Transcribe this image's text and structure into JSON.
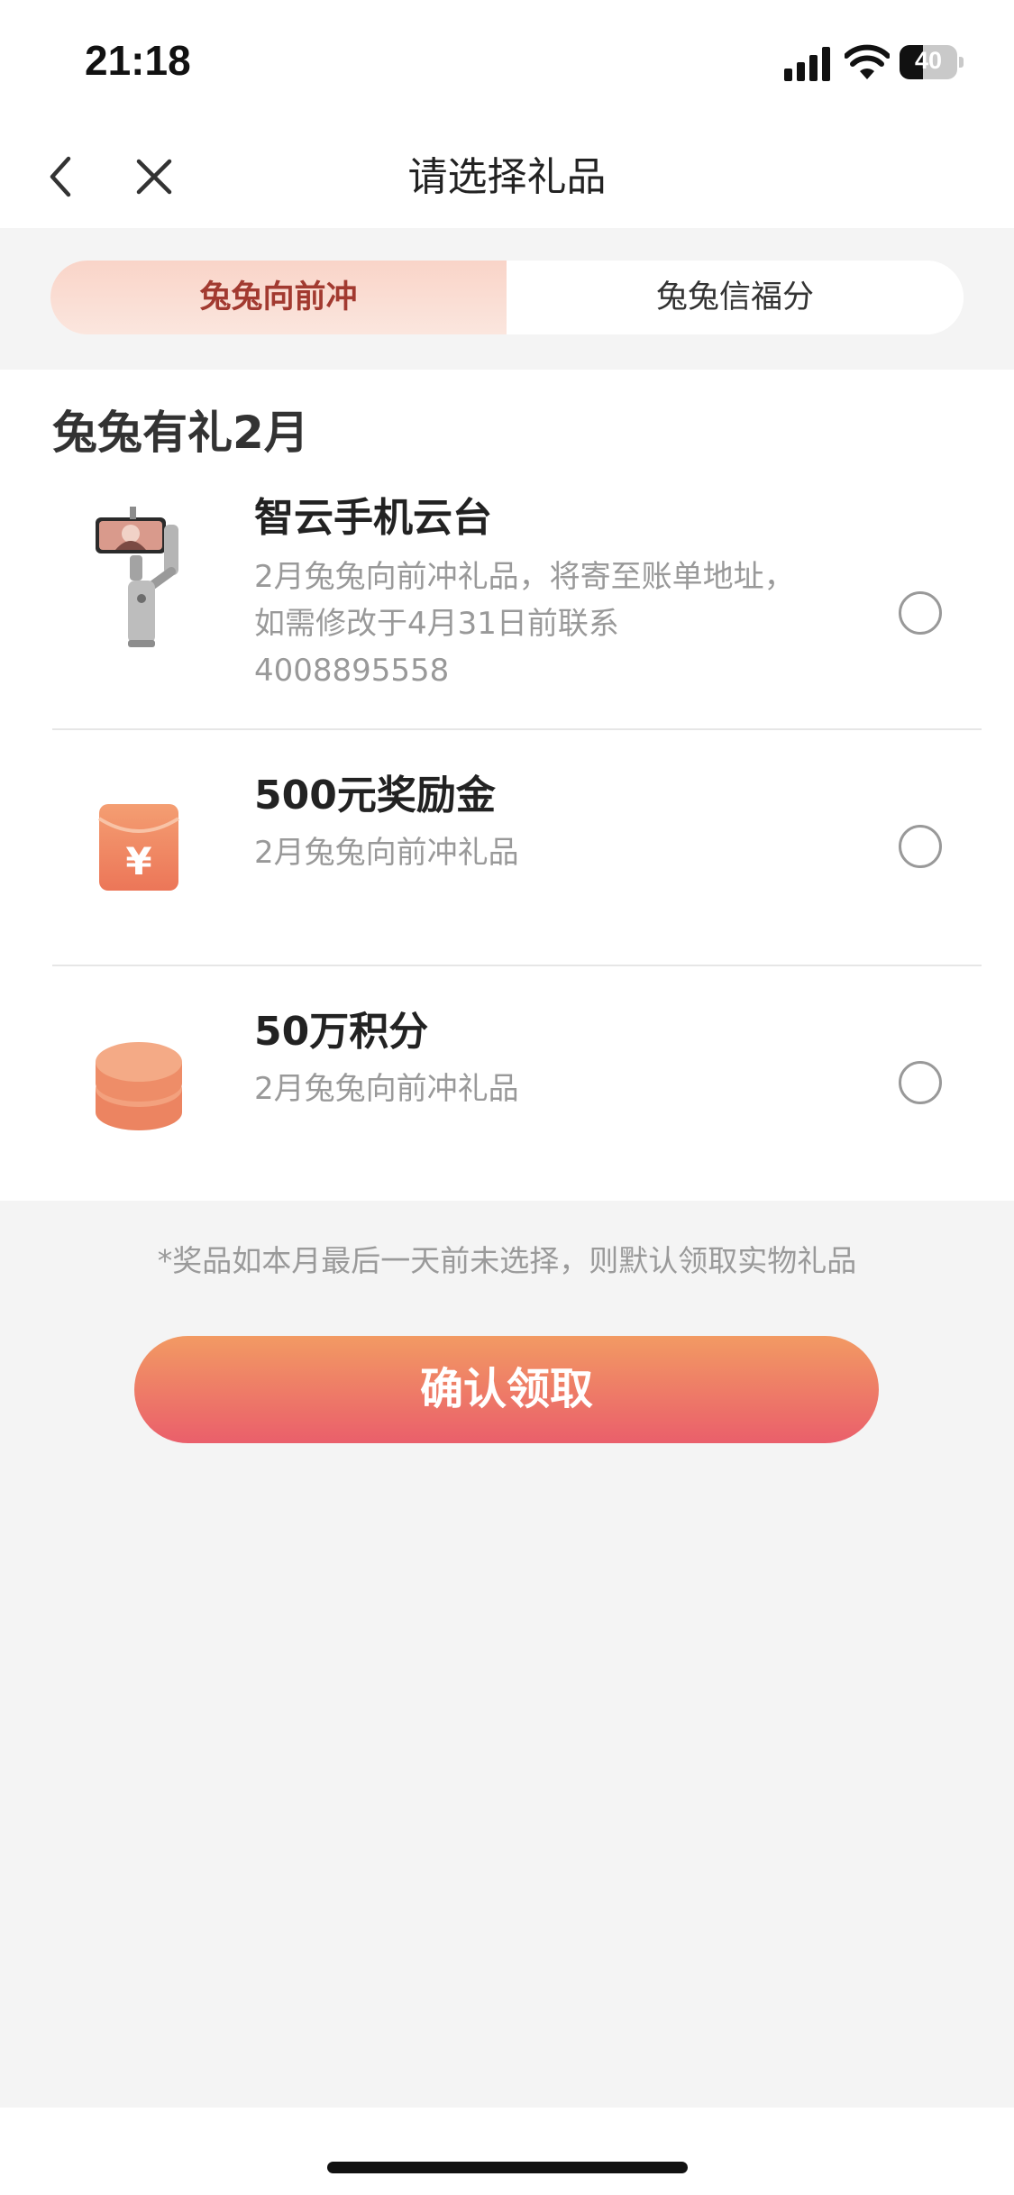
{
  "status": {
    "time": "21:18",
    "battery": "40",
    "battery_level_pct": 40
  },
  "header": {
    "title": "请选择礼品",
    "back_icon": "chevron-left-icon",
    "close_icon": "close-icon"
  },
  "tabs": [
    {
      "label": "兔兔向前冲",
      "active": true
    },
    {
      "label": "兔兔信福分",
      "active": false
    }
  ],
  "section": {
    "title": "兔兔有礼2月"
  },
  "gifts": [
    {
      "title": "智云手机云台",
      "desc": "2月兔兔向前冲礼品，将寄至账单地址，如需修改于4月31日前联系4008895558",
      "icon": "phone-gimbal-image",
      "selected": false
    },
    {
      "title": "500元奖励金",
      "desc": "2月兔兔向前冲礼品",
      "icon": "red-envelope-yen-icon",
      "icon_glyph": "¥",
      "selected": false
    },
    {
      "title": "50万积分",
      "desc": "2月兔兔向前冲礼品",
      "icon": "coin-stack-icon",
      "selected": false
    }
  ],
  "footer": {
    "notice": "*奖品如本月最后一天前未选择，则默认领取实物礼品",
    "confirm_label": "确认领取"
  },
  "colors": {
    "accent_start": "#f29a63",
    "accent_end": "#ea5f6b",
    "active_tab_text": "#a23a30",
    "background": "#f4f4f4"
  }
}
